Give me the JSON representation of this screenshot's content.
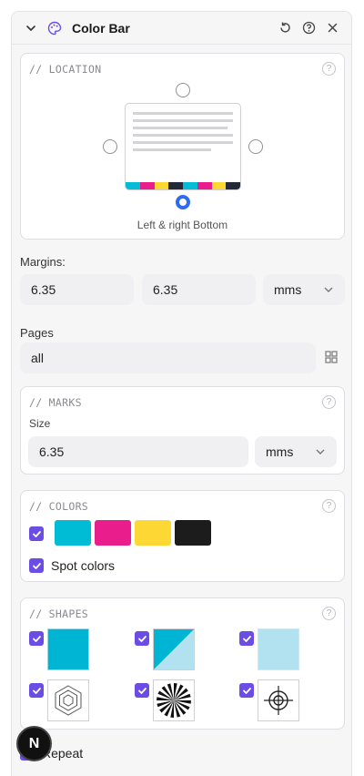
{
  "header": {
    "title": "Color Bar",
    "icons": [
      "chevron-down-icon",
      "palette-icon",
      "reset-icon",
      "help-icon",
      "close-icon"
    ]
  },
  "location": {
    "section_label": "// LOCATION",
    "caption": "Left & right Bottom",
    "selected": "bottom"
  },
  "margins": {
    "label": "Margins:",
    "value1": "6.35",
    "value2": "6.35",
    "unit": "mms"
  },
  "pages": {
    "label": "Pages",
    "value": "all"
  },
  "marks": {
    "section_label": "// MARKS",
    "size_label": "Size",
    "size_value": "6.35",
    "unit": "mms"
  },
  "colors": {
    "section_label": "// COLORS",
    "swatches": [
      "#00bcd4",
      "#e91e8c",
      "#fdd835",
      "#1c1c1c"
    ],
    "spot_label": "Spot colors",
    "spot_checked": true
  },
  "shapes": {
    "section_label": "// SHAPES",
    "items": [
      "cyan-square",
      "cyan-half-triangle",
      "light-cyan-square",
      "concentric-hexagon",
      "radial-star",
      "registration-target"
    ]
  },
  "repeat": {
    "label": "Repeat"
  },
  "help_glyph": "?",
  "avatar": {
    "letter": "N"
  }
}
